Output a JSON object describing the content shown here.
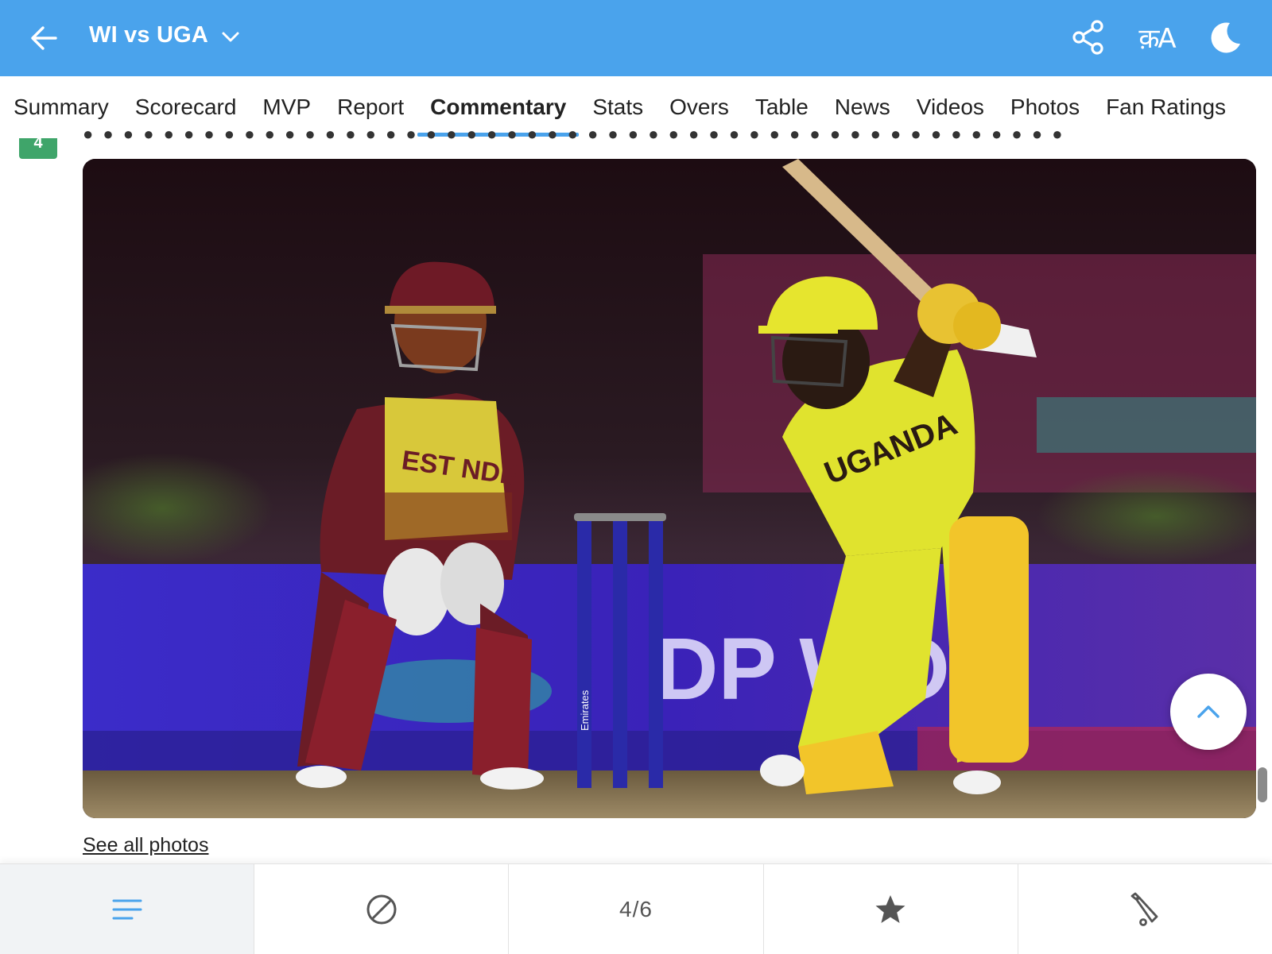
{
  "header": {
    "match_title": "WI vs UGA",
    "language_label": "क़A"
  },
  "tabs": [
    {
      "label": "Summary"
    },
    {
      "label": "Scorecard"
    },
    {
      "label": "MVP"
    },
    {
      "label": "Report"
    },
    {
      "label": "Commentary"
    },
    {
      "label": "Stats"
    },
    {
      "label": "Overs"
    },
    {
      "label": "Table"
    },
    {
      "label": "News"
    },
    {
      "label": "Videos"
    },
    {
      "label": "Photos"
    },
    {
      "label": "Fan Ratings"
    }
  ],
  "active_tab": "Commentary",
  "commentary": {
    "over_badge": "4",
    "photo": {
      "left_jersey_text": "EST NDE",
      "right_jersey_text": "UGANDA",
      "stump_text": "Emirates",
      "boundary_text": "DP WO"
    },
    "see_all_photos": "See all photos"
  },
  "bottom_nav": {
    "pager": "4/6",
    "icons": [
      "menu-icon",
      "ball-icon",
      "pager",
      "star-icon",
      "bat-icon"
    ]
  },
  "colors": {
    "header_bg": "#4aa3ec",
    "accent": "#4aa3ec",
    "over_badge": "#3fa56a"
  }
}
